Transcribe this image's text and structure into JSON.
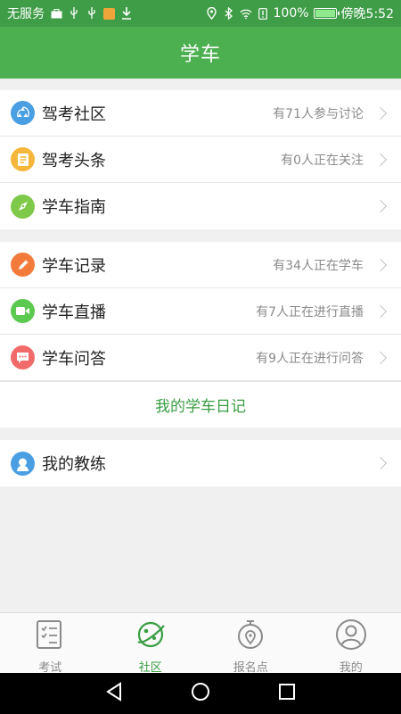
{
  "status_bar": {
    "carrier": "无服务",
    "battery_percent": "100%",
    "time": "傍晚5:52",
    "battery_level": 1.0
  },
  "header": {
    "title": "学车"
  },
  "group1": [
    {
      "label": "驾考社区",
      "sub": "有71人参与讨论",
      "icon": "recycle-icon",
      "color": "#4a9fe3"
    },
    {
      "label": "驾考头条",
      "sub": "有0人正在关注",
      "icon": "document-icon",
      "color": "#f5b73b"
    },
    {
      "label": "学车指南",
      "sub": "",
      "icon": "compass-icon",
      "color": "#7fc94a"
    }
  ],
  "group2": [
    {
      "label": "学车记录",
      "sub": "有34人正在学车",
      "icon": "pencil-icon",
      "color": "#f27b3b"
    },
    {
      "label": "学车直播",
      "sub": "有7人正在进行直播",
      "icon": "video-camera-icon",
      "color": "#5cc950"
    },
    {
      "label": "学车问答",
      "sub": "有9人正在进行问答",
      "icon": "chat-bubble-icon",
      "color": "#f26b6b"
    }
  ],
  "diary": {
    "label": "我的学车日记"
  },
  "group3": [
    {
      "label": "我的教练",
      "sub": "",
      "icon": "person-icon",
      "color": "#4a9fe3"
    }
  ],
  "tabs": [
    {
      "label": "考试",
      "icon": "exam-checklist-icon",
      "active": false
    },
    {
      "label": "社区",
      "icon": "planet-icon",
      "active": true
    },
    {
      "label": "报名点",
      "icon": "stopwatch-location-icon",
      "active": false
    },
    {
      "label": "我的",
      "icon": "user-profile-icon",
      "active": false
    }
  ],
  "colors": {
    "primary": "#4caf50",
    "status_bar": "#3f9d47",
    "accent_text": "#3a9d43"
  }
}
